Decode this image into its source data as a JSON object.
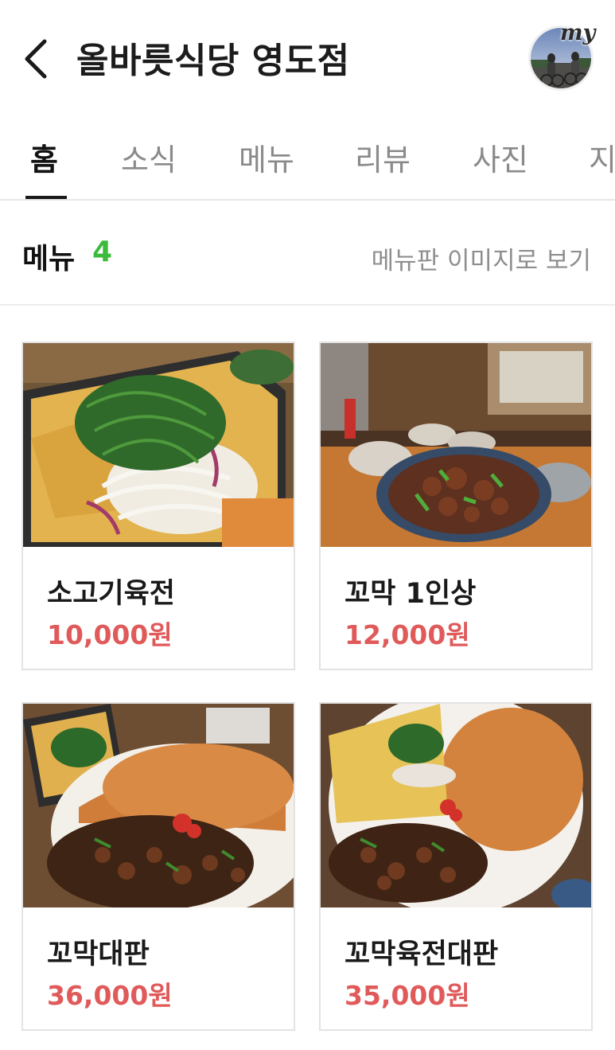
{
  "header": {
    "title": "올바릇식당 영도점",
    "back_icon": "chevron-left-icon",
    "avatar_badge": "my"
  },
  "tabs": [
    {
      "label": "홈",
      "active": true
    },
    {
      "label": "소식",
      "active": false
    },
    {
      "label": "메뉴",
      "active": false
    },
    {
      "label": "리뷰",
      "active": false
    },
    {
      "label": "사진",
      "active": false
    },
    {
      "label": "지",
      "active": false
    }
  ],
  "section": {
    "title": "메뉴",
    "count": "4",
    "view_link": "메뉴판 이미지로 보기",
    "count_color": "#3dbb3d"
  },
  "menu_items": [
    {
      "name": "소고기육전",
      "price": "10,000원"
    },
    {
      "name": "꼬막 1인상",
      "price": "12,000원"
    },
    {
      "name": "꼬막대판",
      "price": "36,000원"
    },
    {
      "name": "꼬막육전대판",
      "price": "35,000원"
    }
  ],
  "colors": {
    "accent_green": "#3dbb3d",
    "price_red": "#e05a5a",
    "tab_active": "#111111",
    "tab_inactive": "#8a8a8a"
  }
}
